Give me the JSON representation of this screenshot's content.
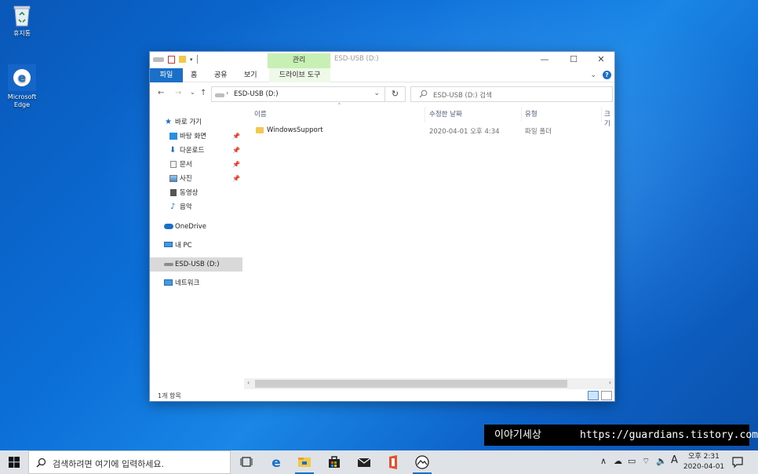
{
  "desktop": {
    "icons": [
      {
        "label": "휴지통"
      },
      {
        "label": "Microsoft Edge"
      }
    ]
  },
  "window": {
    "title": "ESD-USB (D:)",
    "context_tab": "관리",
    "ribbon_tabs": [
      "파일",
      "홈",
      "공유",
      "보기",
      "드라이브 도구"
    ],
    "controls": {
      "minimize": "—",
      "maximize": "☐",
      "close": "✕"
    }
  },
  "address": {
    "path": "ESD-USB (D:)",
    "search_placeholder": "ESD-USB (D:) 검색"
  },
  "nav_pane": {
    "quick_access": "바로 가기",
    "pinned": [
      "바탕 화면",
      "다운로드",
      "문서",
      "사진"
    ],
    "unpinned": [
      "동영상",
      "음악"
    ],
    "onedrive": "OneDrive",
    "thispc": "내 PC",
    "usb": "ESD-USB (D:)",
    "network": "네트워크"
  },
  "columns": [
    "이름",
    "수정한 날짜",
    "유형",
    "크기"
  ],
  "files": [
    {
      "name": "WindowsSupport",
      "date": "2020-04-01 오후 4:34",
      "type": "파일 폴더"
    }
  ],
  "status": {
    "count": "1개 항목"
  },
  "watermark": {
    "name": "이야기세상",
    "url": "https://guardians.tistory.com"
  },
  "taskbar": {
    "search_placeholder": "검색하려면 여기에 입력하세요.",
    "ime": "A",
    "time": "오후 2:31",
    "date": "2020-04-01"
  },
  "colors": {
    "accent": "#1a6fc9",
    "context_tab": "#c8f0b4"
  }
}
